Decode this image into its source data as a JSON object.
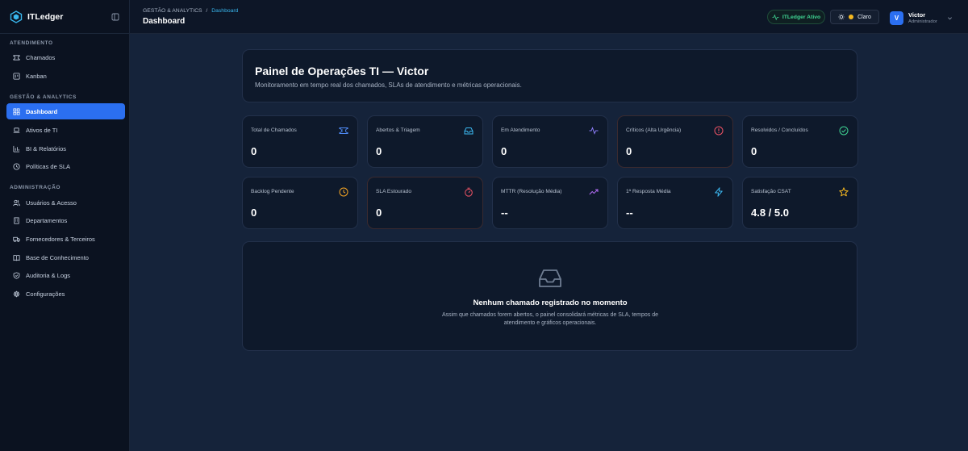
{
  "brand": {
    "name": "ITLedger"
  },
  "sidebar": {
    "sections": [
      {
        "title": "ATENDIMENTO"
      },
      {
        "title": "GESTÃO & ANALYTICS"
      },
      {
        "title": "ADMINISTRAÇÃO"
      }
    ],
    "items": [
      {
        "label": "Chamados",
        "icon": "ticket-icon"
      },
      {
        "label": "Kanban",
        "icon": "kanban-icon"
      },
      {
        "label": "Dashboard",
        "icon": "grid-icon"
      },
      {
        "label": "Ativos de TI",
        "icon": "laptop-icon"
      },
      {
        "label": "BI & Relatórios",
        "icon": "bar-chart-icon"
      },
      {
        "label": "Políticas de SLA",
        "icon": "clock-icon"
      },
      {
        "label": "Usuários & Acesso",
        "icon": "users-icon"
      },
      {
        "label": "Departamentos",
        "icon": "building-icon"
      },
      {
        "label": "Fornecedores & Terceiros",
        "icon": "truck-icon"
      },
      {
        "label": "Base de Conhecimento",
        "icon": "book-icon"
      },
      {
        "label": "Auditoria & Logs",
        "icon": "shield-icon"
      },
      {
        "label": "Configurações",
        "icon": "gear-icon"
      }
    ]
  },
  "header": {
    "breadcrumb_parent": "GESTÃO & ANALYTICS",
    "breadcrumb_sep": "/",
    "breadcrumb_current": "Dashboard",
    "title": "Dashboard",
    "status": "ITLedger Ativo",
    "theme_label": "Claro",
    "user": {
      "initial": "V",
      "name": "Victor",
      "role": "Administrador"
    }
  },
  "hero": {
    "title": "Painel de Operações TI — Victor",
    "subtitle": "Monitoramento em tempo real dos chamados, SLAs de atendimento e métricas operacionais."
  },
  "kpis": [
    {
      "label": "Total de Chamados",
      "value": "0",
      "icon": "ticket-icon",
      "color": "#4f8cf7"
    },
    {
      "label": "Abertos & Triagem",
      "value": "0",
      "icon": "inbox-icon",
      "color": "#3bb6ef"
    },
    {
      "label": "Em Atendimento",
      "value": "0",
      "icon": "activity-icon",
      "color": "#8b7cf6"
    },
    {
      "label": "Críticos (Alta Urgência)",
      "value": "0",
      "icon": "alert-circle-icon",
      "color": "#f05365"
    },
    {
      "label": "Resolvidos / Concluídos",
      "value": "0",
      "icon": "check-circle-icon",
      "color": "#3fd493"
    },
    {
      "label": "Backlog Pendente",
      "value": "0",
      "icon": "clock-icon",
      "color": "#f5a524"
    },
    {
      "label": "SLA Estourado",
      "value": "0",
      "icon": "timer-icon",
      "color": "#f05365"
    },
    {
      "label": "MTTR (Resolução Média)",
      "value": "--",
      "icon": "trending-up-icon",
      "color": "#b36cf5"
    },
    {
      "label": "1ª Resposta Média",
      "value": "--",
      "icon": "zap-icon",
      "color": "#3bb6ef"
    },
    {
      "label": "Satisfação CSAT",
      "value": "4.8 / 5.0",
      "icon": "star-icon",
      "color": "#f5b820"
    }
  ],
  "empty_state": {
    "title": "Nenhum chamado registrado no momento",
    "text": "Assim que chamados forem abertos, o painel consolidará métricas de SLA, tempos de atendimento e gráficos operacionais."
  }
}
